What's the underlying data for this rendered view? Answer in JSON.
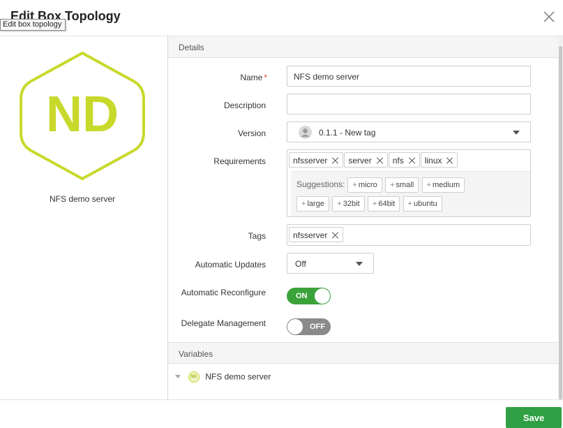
{
  "dialog": {
    "title": "Edit Box Topology",
    "tooltip": "Edit box topology",
    "save_label": "Save"
  },
  "box": {
    "initials": "ND",
    "name": "NFS demo server",
    "color": "#c8d92b"
  },
  "details": {
    "header": "Details",
    "name_label": "Name",
    "name_required_mark": "*",
    "name_value": "NFS demo server",
    "description_label": "Description",
    "description_value": "",
    "version_label": "Version",
    "version_value": "0.1.1 - New tag",
    "requirements_label": "Requirements",
    "requirements": [
      "nfsserver",
      "server",
      "nfs",
      "linux"
    ],
    "suggestions_label": "Suggestions:",
    "suggestions": [
      "micro",
      "small",
      "medium",
      "large",
      "32bit",
      "64bit",
      "ubuntu"
    ],
    "tags_label": "Tags",
    "tags": [
      "nfsserver"
    ],
    "auto_updates_label": "Automatic Updates",
    "auto_updates_value": "Off",
    "auto_reconfigure_label": "Automatic Reconfigure",
    "auto_reconfigure_state": "ON",
    "delegate_label": "Delegate Management",
    "delegate_state": "OFF"
  },
  "variables": {
    "header": "Variables",
    "item_badge": "ND",
    "item_label": "NFS demo server"
  },
  "colors": {
    "accent_green": "#3ba23a",
    "save_green": "#2fa043",
    "required_red": "#e04040"
  }
}
